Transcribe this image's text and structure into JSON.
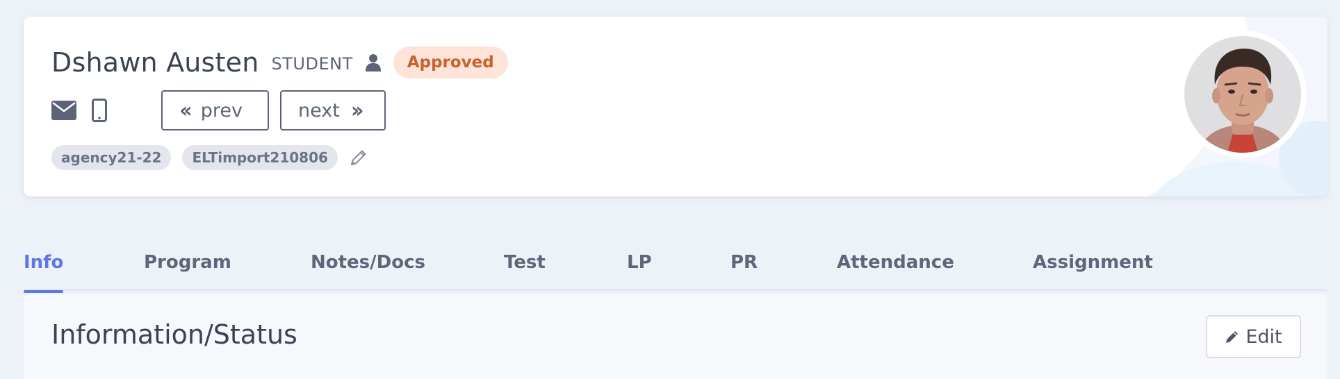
{
  "profile": {
    "name": "Dshawn Austen",
    "role": "STUDENT",
    "status": "Approved",
    "prev_label": "prev",
    "next_label": "next",
    "tags": [
      "agency21-22",
      "ELTimport210806"
    ],
    "icons": {
      "role": "person-icon",
      "email": "envelope-icon",
      "phone": "mobile-phone-icon",
      "edit_tags": "pencil-icon",
      "prev": "double-chevron-left-icon",
      "next": "double-chevron-right-icon"
    }
  },
  "tabs": [
    {
      "label": "Info",
      "active": true
    },
    {
      "label": "Program",
      "active": false
    },
    {
      "label": "Notes/Docs",
      "active": false
    },
    {
      "label": "Test",
      "active": false
    },
    {
      "label": "LP",
      "active": false
    },
    {
      "label": "PR",
      "active": false
    },
    {
      "label": "Attendance",
      "active": false
    },
    {
      "label": "Assignment",
      "active": false
    }
  ],
  "section": {
    "title": "Information/Status",
    "edit_label": "Edit"
  },
  "colors": {
    "accent": "#5a78e8",
    "status_bg": "#fde3d8",
    "status_text": "#c8622e",
    "background": "#edf1f8"
  }
}
